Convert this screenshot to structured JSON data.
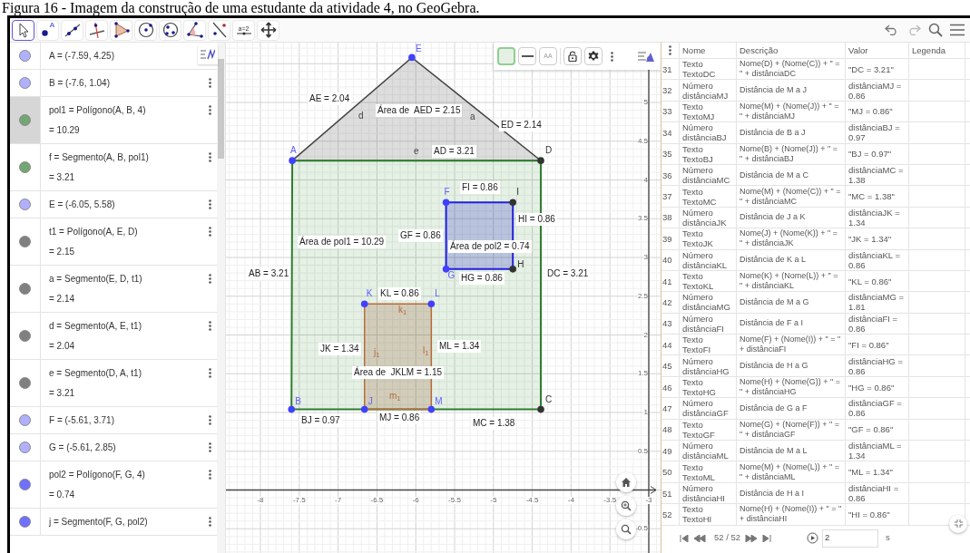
{
  "caption": "Figura 16 - Imagem da construção de uma estudante da atividade 4, no GeoGebra.",
  "toolbar": {
    "tools": [
      {
        "kind": "move",
        "selected": true
      },
      {
        "kind": "point",
        "label": "A",
        "selected": false
      },
      {
        "kind": "line",
        "selected": false
      },
      {
        "kind": "perpendicular",
        "selected": false
      },
      {
        "kind": "polygon",
        "selected": false
      },
      {
        "kind": "circle",
        "selected": false
      },
      {
        "kind": "ellipse",
        "selected": false
      },
      {
        "kind": "angle",
        "selected": false
      },
      {
        "kind": "reflect",
        "selected": false
      },
      {
        "kind": "slider",
        "label": "a=2",
        "selected": false
      },
      {
        "kind": "pan",
        "selected": false
      }
    ]
  },
  "algebra": [
    {
      "text": "A = (-7.59, 4.25)",
      "color": "#b0b0ff",
      "selected": false,
      "menu": false
    },
    {
      "text": "B = (-7.6, 1.04)",
      "color": "#b0b0ff",
      "selected": false,
      "menu": true
    },
    {
      "text": "pol1 = Polígono(A, B, 4)",
      "value": "= 10.29",
      "color": "#73a673",
      "selected": true,
      "menu": true
    },
    {
      "text": "f = Segmento(A, B, pol1)",
      "value": "= 3.21",
      "color": "#73a673",
      "selected": false,
      "menu": true
    },
    {
      "text": "E = (-6.05, 5.58)",
      "color": "#b0b0ff",
      "selected": false,
      "menu": true
    },
    {
      "text": "t1 = Polígono(A, E, D)",
      "value": "= 2.15",
      "color": "#808080",
      "selected": false,
      "menu": true
    },
    {
      "text": "a = Segmento(E, D, t1)",
      "value": "= 2.14",
      "color": "#808080",
      "selected": false,
      "menu": true
    },
    {
      "text": "d = Segmento(A, E, t1)",
      "value": "= 2.04",
      "color": "#808080",
      "selected": false,
      "menu": true
    },
    {
      "text": "e = Segmento(D, A, t1)",
      "value": "= 3.21",
      "color": "#808080",
      "selected": false,
      "menu": true
    },
    {
      "text": "F = (-5.61, 3.71)",
      "color": "#b0b0ff",
      "selected": false,
      "menu": true
    },
    {
      "text": "G = (-5.61, 2.85)",
      "color": "#b0b0ff",
      "selected": false,
      "menu": true
    },
    {
      "text": "pol2 = Polígono(F, G, 4)",
      "value": "= 0.74",
      "color": "#7070ff",
      "selected": false,
      "menu": true
    },
    {
      "text": "j = Segmento(F, G, pol2)",
      "color": "#7070ff",
      "selected": false,
      "menu": true
    }
  ],
  "style_bar": {
    "label_button": "AA"
  },
  "graphics": {
    "x_ticks": [
      "-8",
      "-7.5",
      "-7",
      "-6.5",
      "-6",
      "-5.5",
      "-5",
      "-4.5",
      "-4",
      "-3.5",
      "-3"
    ],
    "y_ticks": [
      "5",
      "4.5",
      "4",
      "3.5",
      "3",
      "2.5",
      "2",
      "1.5",
      "1",
      "0.5",
      "-0.5"
    ],
    "points": [
      {
        "label": "E",
        "color": "#4040ff"
      },
      {
        "label": "A",
        "color": "#4040ff"
      },
      {
        "label": "D",
        "color": "#333333"
      },
      {
        "label": "F",
        "color": "#4040ff"
      },
      {
        "label": "I",
        "color": "#333333"
      },
      {
        "label": "G",
        "color": "#4040ff"
      },
      {
        "label": "H",
        "color": "#333333"
      },
      {
        "label": "K",
        "color": "#4040ff"
      },
      {
        "label": "L",
        "color": "#4040ff"
      },
      {
        "label": "B",
        "color": "#4040ff"
      },
      {
        "label": "J",
        "color": "#4040ff"
      },
      {
        "label": "M",
        "color": "#4040ff"
      },
      {
        "label": "C",
        "color": "#333333"
      }
    ],
    "segment_names": [
      "d",
      "a",
      "e",
      "k$_{1}$",
      "j$_{1}$",
      "l$_{1}$",
      "m$_{1}$"
    ],
    "captions": [
      "AE = 2.04",
      "Área de  AED = 2.15",
      "ED = 2.14",
      "AD = 3.21",
      "FI = 0.86",
      "HI = 0.86",
      "GF = 0.86",
      "Área de pol2 = 0.74",
      "Área de pol1 = 10.29",
      "AB = 3.21",
      "DC = 3.21",
      "HG = 0.86",
      "KL = 0.86",
      "JK = 1.34",
      "ML = 1.34",
      "Área de  JKLM = 1.15",
      "BJ = 0.97",
      "MJ = 0.86",
      "MC = 1.38"
    ]
  },
  "table": {
    "columns": [
      "Nome",
      "Descrição",
      "Valor",
      "Legenda"
    ],
    "rows": [
      {
        "index": "31",
        "nome": "Texto TextoDC",
        "descricao": "Nome(D) + (Nome(C)) + \" = \" + distânciaDC",
        "valor": "\"DC = 3.21\""
      },
      {
        "index": "32",
        "nome": "Número distânciaMJ",
        "descricao": "Distância de M a J",
        "valor": "distânciaMJ = 0.86"
      },
      {
        "index": "33",
        "nome": "Texto TextoMJ",
        "descricao": "Nome(M) + (Nome(J)) + \" = \" + distânciaMJ",
        "valor": "\"MJ = 0.86\""
      },
      {
        "index": "34",
        "nome": "Número distânciaBJ",
        "descricao": "Distância de B a J",
        "valor": "distânciaBJ = 0.97"
      },
      {
        "index": "35",
        "nome": "Texto TextoBJ",
        "descricao": "Nome(B) + (Nome(J)) + \" = \" + distânciaBJ",
        "valor": "\"BJ = 0.97\""
      },
      {
        "index": "36",
        "nome": "Número distânciaMC",
        "descricao": "Distância de M a C",
        "valor": "distânciaMC = 1.38"
      },
      {
        "index": "37",
        "nome": "Texto TextoMC",
        "descricao": "Nome(M) + (Nome(C)) + \" = \" + distânciaMC",
        "valor": "\"MC = 1.38\""
      },
      {
        "index": "38",
        "nome": "Número distânciaJK",
        "descricao": "Distância de J a K",
        "valor": "distânciaJK = 1.34"
      },
      {
        "index": "39",
        "nome": "Texto TextoJK",
        "descricao": "Nome(J) + (Nome(K)) + \" = \" + distânciaJK",
        "valor": "\"JK = 1.34\""
      },
      {
        "index": "40",
        "nome": "Número distânciaKL",
        "descricao": "Distância de K a L",
        "valor": "distânciaKL = 0.86"
      },
      {
        "index": "41",
        "nome": "Texto TextoKL",
        "descricao": "Nome(K) + (Nome(L)) + \" = \" + distânciaKL",
        "valor": "\"KL = 0.86\""
      },
      {
        "index": "42",
        "nome": "Número distânciaMG",
        "descricao": "Distância de M a G",
        "valor": "distânciaMG = 1.81"
      },
      {
        "index": "43",
        "nome": "Número distânciaFI",
        "descricao": "Distância de F a I",
        "valor": "distânciaFI = 0.86"
      },
      {
        "index": "44",
        "nome": "Texto TextoFI",
        "descricao": "Nome(F) + (Nome(I)) + \" = \" + distânciaFI",
        "valor": "\"FI = 0.86\""
      },
      {
        "index": "45",
        "nome": "Número distânciaHG",
        "descricao": "Distância de H a G",
        "valor": "distânciaHG = 0.86"
      },
      {
        "index": "46",
        "nome": "Texto TextoHG",
        "descricao": "Nome(H) + (Nome(G)) + \" = \" + distânciaHG",
        "valor": "\"HG = 0.86\""
      },
      {
        "index": "47",
        "nome": "Número distânciaGF",
        "descricao": "Distância de G a F",
        "valor": "distânciaGF = 0.86"
      },
      {
        "index": "48",
        "nome": "Texto TextoGF",
        "descricao": "Nome(G) + (Nome(F)) + \" = \" + distânciaGF",
        "valor": "\"GF = 0.86\""
      },
      {
        "index": "49",
        "nome": "Número distânciaML",
        "descricao": "Distância de M a L",
        "valor": "distânciaML = 1.34"
      },
      {
        "index": "50",
        "nome": "Texto TextoML",
        "descricao": "Nome(M) + (Nome(L)) + \" = \" + distânciaML",
        "valor": "\"ML = 1.34\""
      },
      {
        "index": "51",
        "nome": "Número distânciaHI",
        "descricao": "Distância de H a I",
        "valor": "distânciaHI = 0.86"
      },
      {
        "index": "52",
        "nome": "Texto TextoHI",
        "descricao": "Nome(H) + (Nome(I)) + \" = \" + distânciaHI",
        "valor": "\"HI = 0.86\""
      }
    ],
    "footer": {
      "position": "52 / 52",
      "speed": "2",
      "unit": "s"
    }
  }
}
